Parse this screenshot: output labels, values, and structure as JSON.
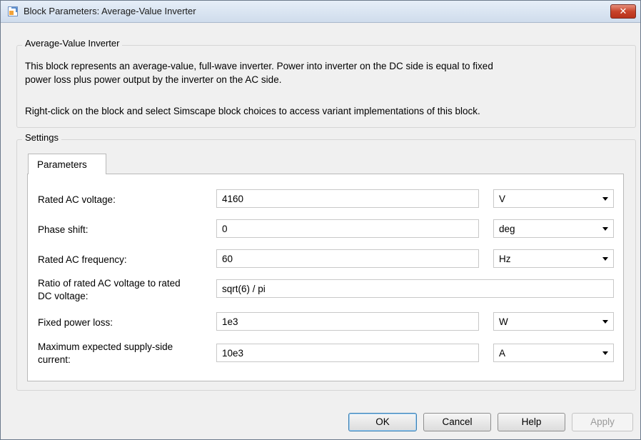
{
  "window": {
    "title": "Block Parameters: Average-Value Inverter",
    "close_symbol": "✕"
  },
  "description": {
    "group_title": "Average-Value Inverter",
    "line1": "This block represents an average-value, full-wave inverter. Power into inverter on the DC side is equal to fixed",
    "line2": "power loss plus power output by the inverter on the AC side.",
    "line3": "Right-click on the block and select Simscape block choices to access variant implementations of this block."
  },
  "settings": {
    "group_title": "Settings",
    "tab_label": "Parameters",
    "params": [
      {
        "label": "Rated AC voltage:",
        "value": "4160",
        "unit": "V"
      },
      {
        "label": "Phase shift:",
        "value": "0",
        "unit": "deg"
      },
      {
        "label": "Rated AC frequency:",
        "value": "60",
        "unit": "Hz"
      },
      {
        "label_line1": "Ratio of rated AC voltage to rated",
        "label_line2": "DC voltage:",
        "value": "sqrt(6) / pi"
      },
      {
        "label": "Fixed power loss:",
        "value": "1e3",
        "unit": "W"
      },
      {
        "label_line1": "Maximum expected supply-side",
        "label_line2": "current:",
        "value": "10e3",
        "unit": "A"
      }
    ]
  },
  "buttons": {
    "ok": "OK",
    "cancel": "Cancel",
    "help": "Help",
    "apply": "Apply"
  },
  "colors": {
    "close_button": "#c8432a",
    "default_button_border": "#3c7fb1"
  },
  "icons": {
    "title": "simulink-block-icon",
    "dropdown": "chevron-down-icon"
  }
}
